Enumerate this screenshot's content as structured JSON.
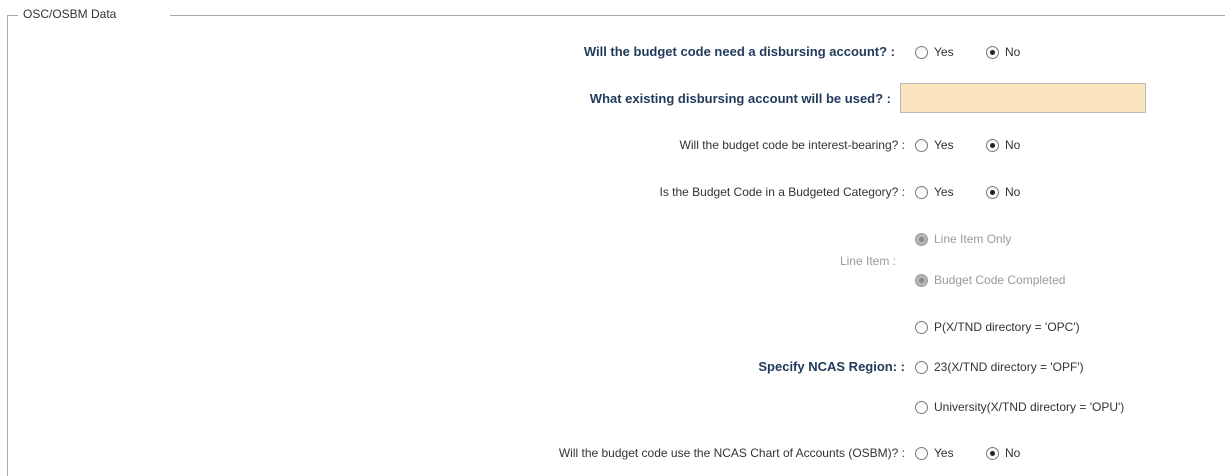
{
  "fieldset": {
    "legend": "OSC/OSBM Data"
  },
  "disbursing_account": {
    "question": "Will the budget code need a disbursing account? :",
    "options": [
      {
        "label": "Yes",
        "checked": false
      },
      {
        "label": "No",
        "checked": true
      }
    ]
  },
  "existing_account": {
    "question": "What existing disbursing account will be used? :",
    "value": ""
  },
  "interest_bearing": {
    "question": "Will the budget code be interest-bearing? :",
    "options": [
      {
        "label": "Yes",
        "checked": false
      },
      {
        "label": "No",
        "checked": true
      }
    ]
  },
  "budgeted_category": {
    "question": "Is the Budget Code in a Budgeted Category? :",
    "options": [
      {
        "label": "Yes",
        "checked": false
      },
      {
        "label": "No",
        "checked": true
      }
    ]
  },
  "line_item": {
    "question": "Line Item :",
    "options": [
      {
        "label": "Line Item Only",
        "checked": true,
        "disabled": true
      },
      {
        "label": "Budget Code Completed",
        "checked": true,
        "disabled": true
      }
    ]
  },
  "ncas_region": {
    "question": "Specify NCAS Region: :",
    "options": [
      {
        "label": "P(X/TND directory = 'OPC')",
        "checked": false
      },
      {
        "label": "23(X/TND directory = 'OPF')",
        "checked": false
      },
      {
        "label": "University(X/TND directory = 'OPU')",
        "checked": false
      }
    ]
  },
  "ncas_chart": {
    "question": "Will the budget code use the NCAS Chart of Accounts (OSBM)? :",
    "options": [
      {
        "label": "Yes",
        "checked": false
      },
      {
        "label": "No",
        "checked": true
      }
    ]
  }
}
